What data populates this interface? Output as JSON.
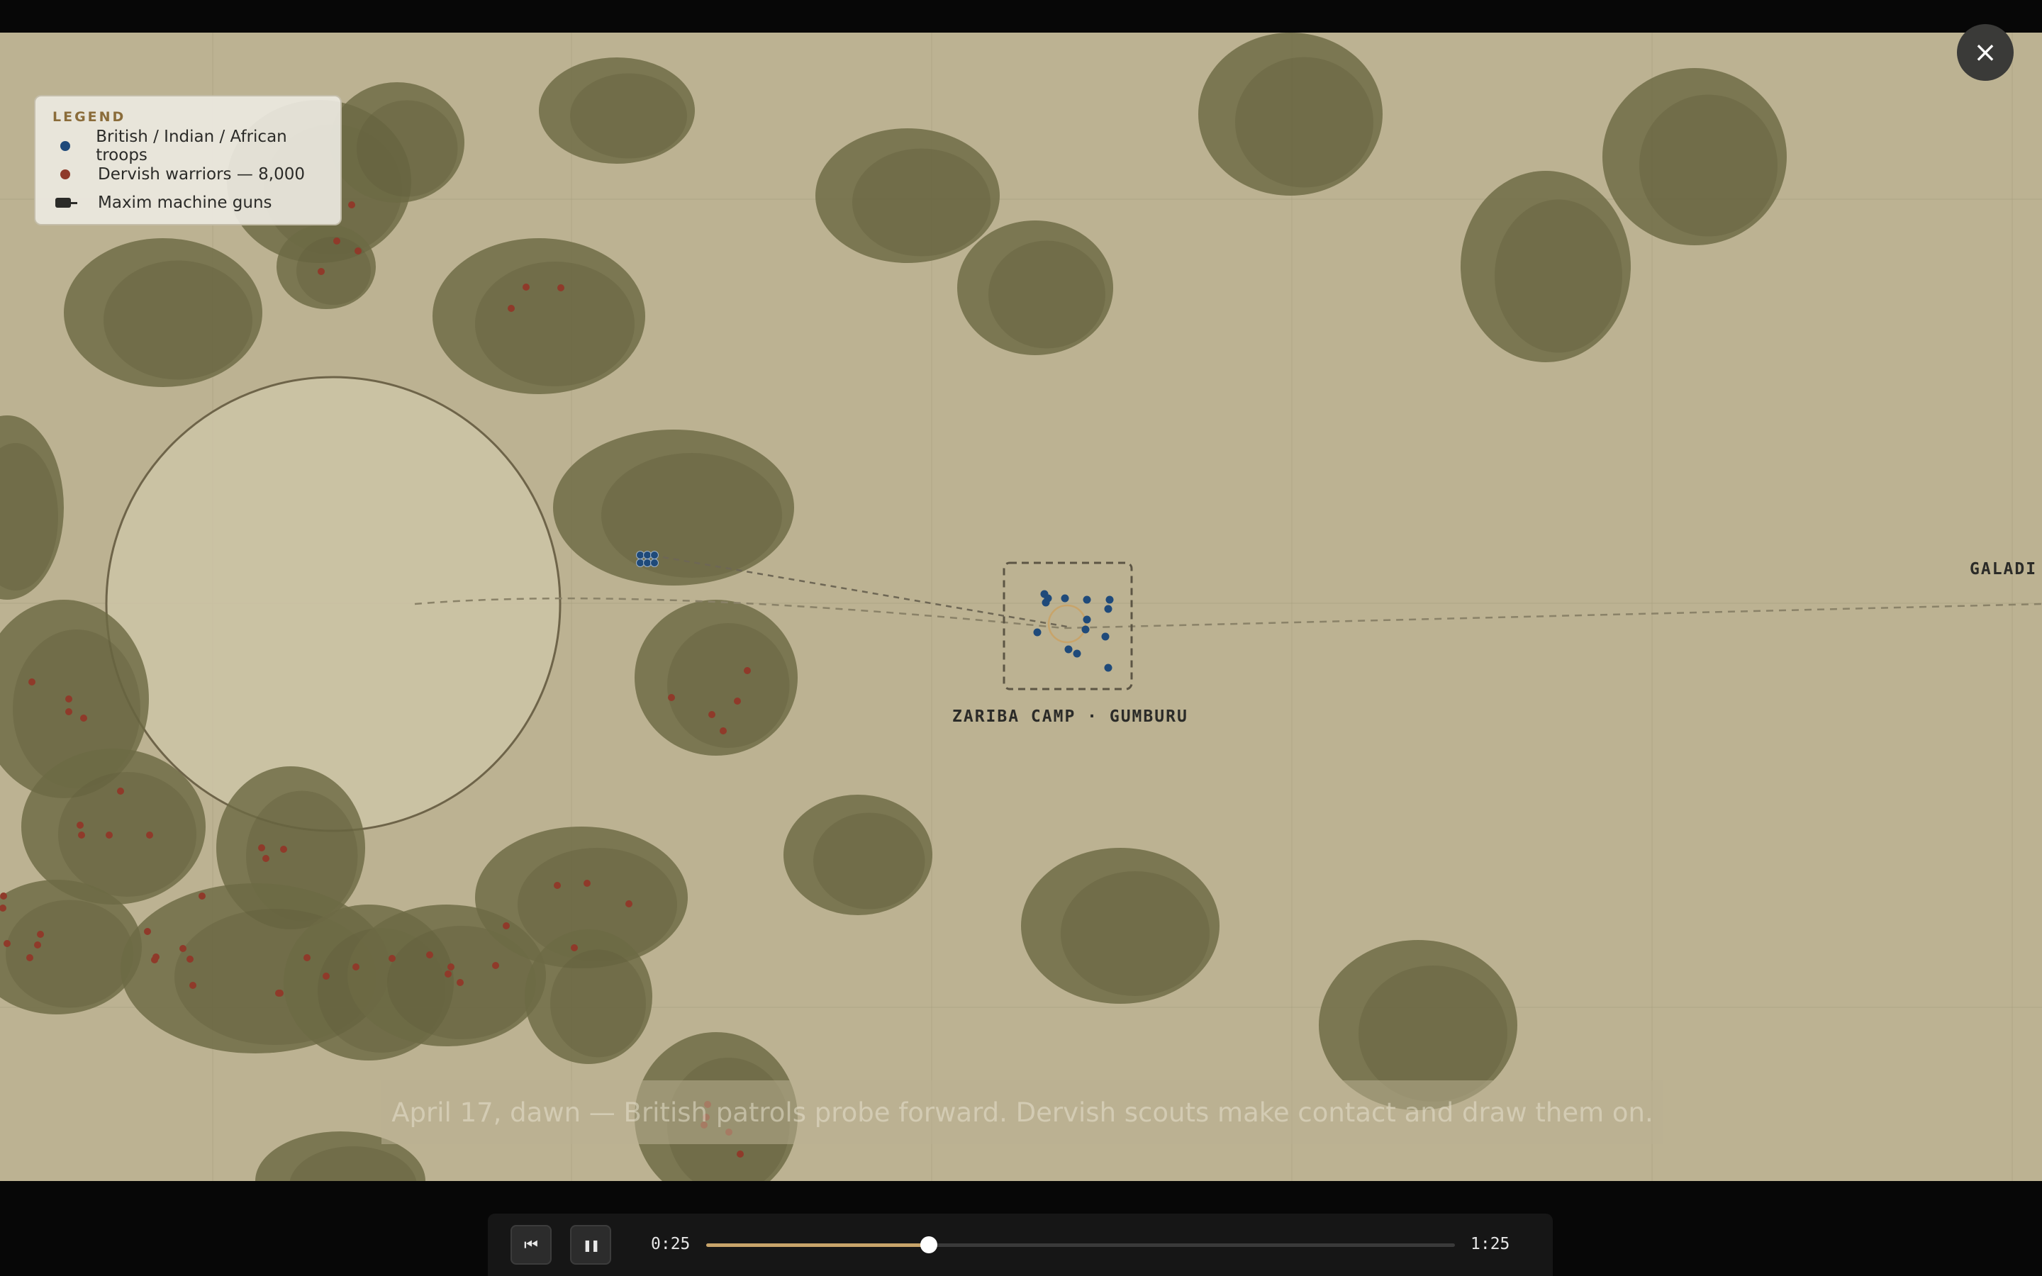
{
  "legend": {
    "title": "LEGEND",
    "items": [
      {
        "label": "British / Indian / African troops",
        "color": "#1f4a7a"
      },
      {
        "label": "Dervish warriors — 8,000",
        "color": "#8f3a2a"
      },
      {
        "label": "Maxim machine guns",
        "icon": "maxim-gun-icon",
        "color": "#2b2b28"
      }
    ]
  },
  "map": {
    "labels": {
      "camp": "ZARIBA CAMP · GUMBURU",
      "edge": "GALADI"
    },
    "colors": {
      "ground": "#bcb292",
      "bush": "#6c6a44",
      "clearing": "#cdc4a6",
      "british": "#1f4a7a",
      "dervish": "#8f3a2a"
    }
  },
  "caption": "April 17, dawn — British patrols probe forward. Dervish scouts make contact and draw them on.",
  "player": {
    "close_icon": "×",
    "restart_icon": "⏮",
    "pause_icon": "❚❚",
    "elapsed": "0:25",
    "total": "1:25",
    "progress": 0.297
  }
}
